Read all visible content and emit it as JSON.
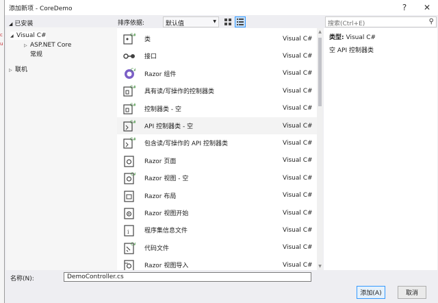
{
  "window": {
    "title": "添加新项 - CoreDemo",
    "help": "?",
    "close": "✕"
  },
  "left": {
    "header": "已安装",
    "tree": [
      {
        "label": "Visual C#",
        "expander": "◢",
        "selected": true
      },
      {
        "label": "ASP.NET Core",
        "expander": "▷"
      },
      {
        "label": "常规"
      },
      {
        "label": "联机",
        "expander": "▷"
      }
    ]
  },
  "sort": {
    "label": "排序依据:",
    "value": "默认值"
  },
  "search": {
    "placeholder": "搜索(Ctrl+E)"
  },
  "templates": [
    {
      "name": "类",
      "lang": "Visual C#",
      "icon": "class-icon"
    },
    {
      "name": "接口",
      "lang": "Visual C#",
      "icon": "interface-icon"
    },
    {
      "name": "Razor 组件",
      "lang": "Visual C#",
      "icon": "razor-component-icon"
    },
    {
      "name": "具有读/写操作的控制器类",
      "lang": "Visual C#",
      "icon": "controller-icon"
    },
    {
      "name": "控制器类 - 空",
      "lang": "Visual C#",
      "icon": "controller-icon"
    },
    {
      "name": "API 控制器类 - 空",
      "lang": "Visual C#",
      "icon": "api-controller-icon",
      "selected": true
    },
    {
      "name": "包含读/写操作的 API 控制器类",
      "lang": "Visual C#",
      "icon": "api-controller-icon"
    },
    {
      "name": "Razor 页面",
      "lang": "Visual C#",
      "icon": "razor-page-icon"
    },
    {
      "name": "Razor 视图 - 空",
      "lang": "Visual C#",
      "icon": "razor-view-icon"
    },
    {
      "name": "Razor 布局",
      "lang": "Visual C#",
      "icon": "razor-layout-icon"
    },
    {
      "name": "Razor 视图开始",
      "lang": "Visual C#",
      "icon": "razor-viewstart-icon"
    },
    {
      "name": "程序集信息文件",
      "lang": "Visual C#",
      "icon": "assembly-info-icon"
    },
    {
      "name": "代码文件",
      "lang": "Visual C#",
      "icon": "code-file-icon"
    },
    {
      "name": "Razor 视图导入",
      "lang": "Visual C#",
      "icon": "razor-viewimports-icon"
    }
  ],
  "detail": {
    "type_label": "类型:",
    "type_value": "Visual C#",
    "description": "空 API 控制器类"
  },
  "name_field": {
    "label": "名称(N):",
    "value": "DemoController.cs"
  },
  "buttons": {
    "add": "添加(A)",
    "cancel": "取消"
  }
}
